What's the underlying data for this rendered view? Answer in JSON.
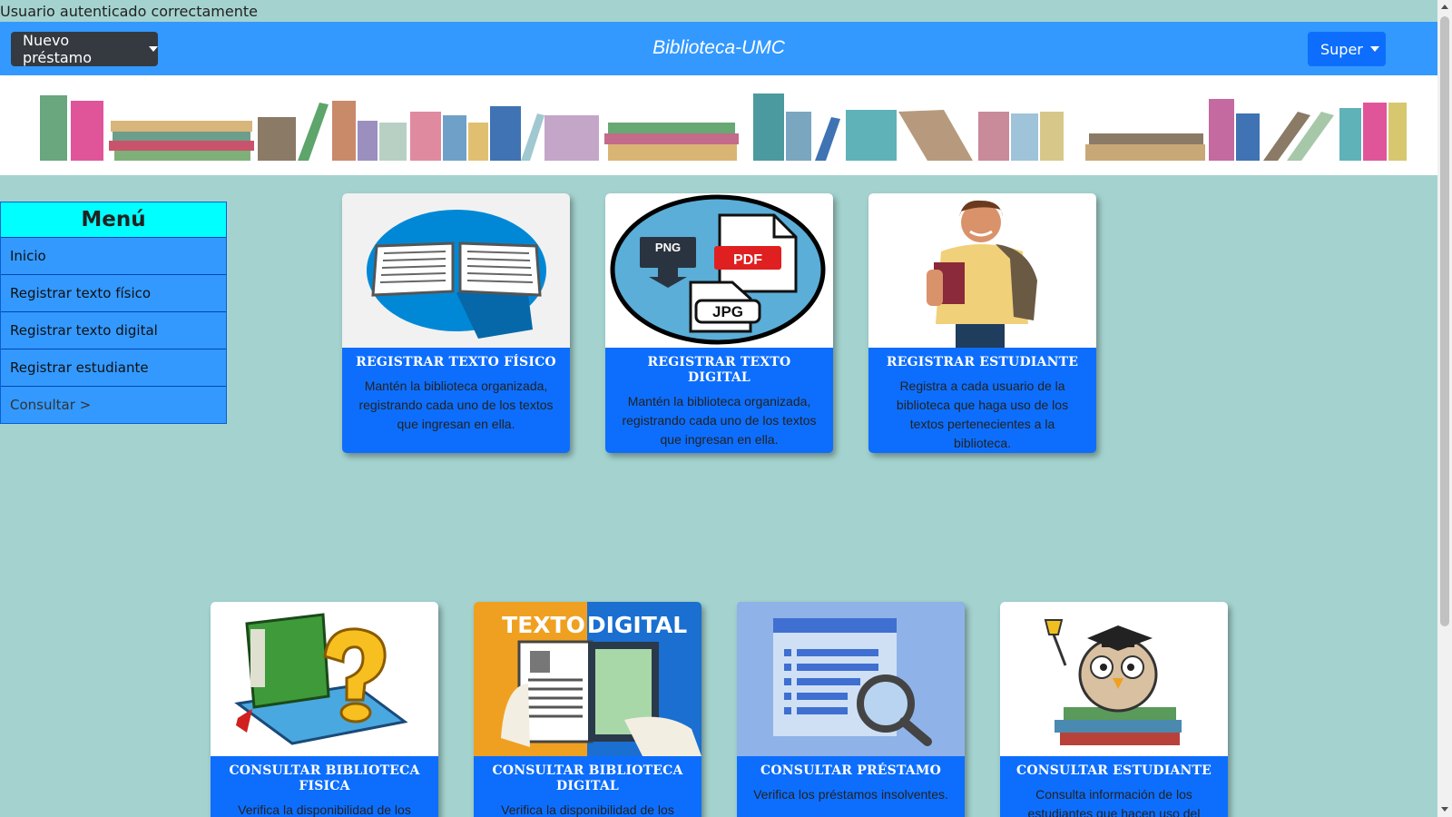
{
  "alert": {
    "text": "Usuario autenticado correctamente"
  },
  "navbar": {
    "loan_button": "Nuevo préstamo",
    "brand": "Biblioteca-UMC",
    "user_button": "Super"
  },
  "menu": {
    "title": "Menú",
    "items": [
      {
        "label": "Inicio"
      },
      {
        "label": "Registrar texto físico"
      },
      {
        "label": "Registrar texto digital"
      },
      {
        "label": "Registrar estudiante"
      },
      {
        "label": "Consultar >"
      }
    ]
  },
  "cards_top": [
    {
      "icon": "open-book-icon",
      "title": "REGISTRAR TEXTO FÍSICO",
      "desc": "Mantén la biblioteca organizada, registrando cada uno de los textos que ingresan en ella."
    },
    {
      "icon": "file-formats-icon",
      "title": "REGISTRAR TEXTO DIGITAL",
      "desc": "Mantén la biblioteca organizada, registrando cada uno de los textos que ingresan en ella.",
      "labels": [
        "PNG",
        "PDF",
        "JPG"
      ]
    },
    {
      "icon": "student-icon",
      "title": "REGISTRAR ESTUDIANTE",
      "desc": "Registra a cada usuario de la biblioteca que haga uso de los textos pertenecientes a la biblioteca."
    }
  ],
  "cards_bottom": [
    {
      "icon": "books-question-icon",
      "title": "CONSULTAR BIBLIOTECA FISICA",
      "desc": "Verifica la disponibilidad de los"
    },
    {
      "icon": "digital-text-icon",
      "title": "CONSULTAR BIBLIOTECA DIGITAL",
      "desc": "Verifica la disponibilidad de los",
      "image_text": [
        "TEXTO",
        "DIGITAL"
      ]
    },
    {
      "icon": "search-document-icon",
      "title": "CONSULTAR PRÉSTAMO",
      "desc": "Verifica los préstamos insolventes."
    },
    {
      "icon": "owl-graduate-icon",
      "title": "CONSULTAR ESTUDIANTE",
      "desc": "Consulta información de los estudiantes que hacen uso del"
    }
  ],
  "colors": {
    "background": "#a4d3cf",
    "navbar": "#3399ff",
    "card": "#0d6efd",
    "menu_title": "#00ffff"
  }
}
